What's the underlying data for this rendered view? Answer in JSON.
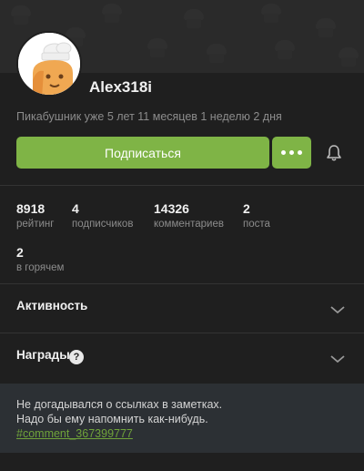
{
  "profile": {
    "username": "Alex318i",
    "since": "Пикабушник уже 5 лет 11 месяцев 1 неделю 2 дня",
    "avatar_icon": "chef-avatar-icon"
  },
  "actions": {
    "subscribe_label": "Подписаться",
    "more_icon": "more-dots-icon",
    "bell_icon": "bell-icon",
    "accent_color": "#7fb446"
  },
  "stats": [
    {
      "value": "8918",
      "label": "рейтинг"
    },
    {
      "value": "4",
      "label": "подписчиков"
    },
    {
      "value": "14326",
      "label": "комментариев"
    },
    {
      "value": "2",
      "label": "поста"
    },
    {
      "value": "2",
      "label": "в горячем"
    }
  ],
  "sections": {
    "activity": "Активность",
    "awards": "Награды"
  },
  "note": {
    "line1": "Не догадывался о ссылках в заметках.",
    "line2": "Надо бы ему напомнить как-нибудь.",
    "link": "#comment_367399777",
    "link_color": "#6fa33a"
  }
}
